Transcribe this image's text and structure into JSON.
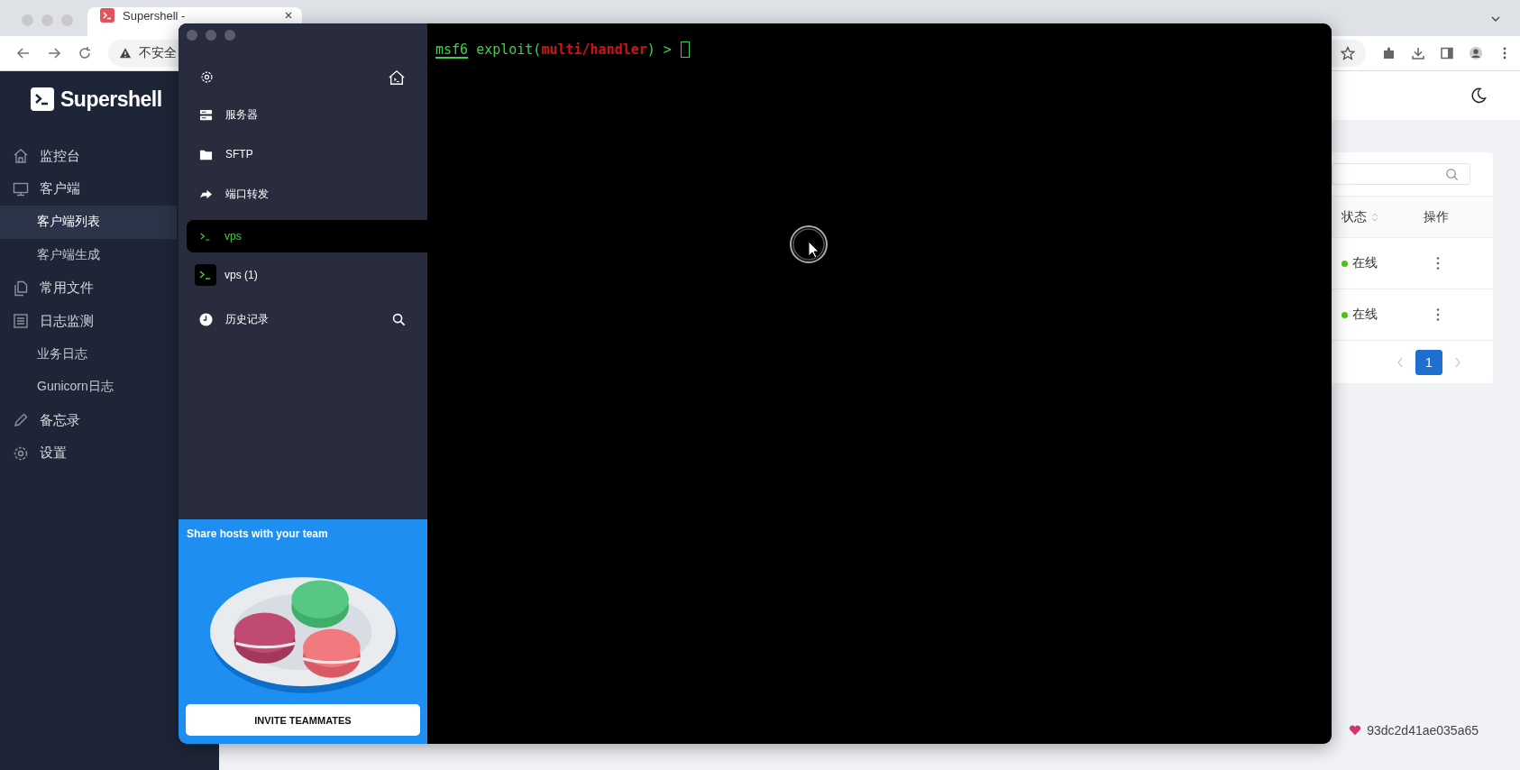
{
  "browser": {
    "tab_title": "Supershell -",
    "security_label": "不安全"
  },
  "sidebar": {
    "logo_text": "Supershell",
    "items": [
      {
        "label": "监控台",
        "selected": false
      },
      {
        "label": "客户端",
        "selected": false,
        "children": [
          {
            "label": "客户端列表",
            "selected": true
          },
          {
            "label": "客户端生成",
            "selected": false
          }
        ]
      },
      {
        "label": "常用文件",
        "selected": false
      },
      {
        "label": "日志监测",
        "selected": false,
        "children": [
          {
            "label": "业务日志",
            "selected": false
          },
          {
            "label": "Gunicorn日志",
            "selected": false
          }
        ]
      },
      {
        "label": "备忘录",
        "selected": false
      },
      {
        "label": "设置",
        "selected": false
      }
    ]
  },
  "table": {
    "columns": [
      "状态",
      "操作"
    ],
    "rows": [
      {
        "status": "在线",
        "color": "#52c41a"
      },
      {
        "status": "在线",
        "color": "#52c41a"
      }
    ]
  },
  "pagination": {
    "pages": [
      {
        "label": "1",
        "selected": true
      }
    ]
  },
  "footer": {
    "hash": "93dc2d41ae035a65"
  },
  "terminal_app": {
    "nav": [
      "服务器",
      "SFTP",
      "端口转发"
    ],
    "hosts": [
      {
        "label": "vps",
        "selected": true
      },
      {
        "label": "vps (1)",
        "selected": false
      }
    ],
    "history": "历史记录",
    "promo": {
      "title": "Share hosts with your team",
      "button": "INVITE TEAMMATES"
    },
    "prompt": [
      {
        "text": "msf6",
        "kind": "keyword"
      },
      {
        "text": " exploit(",
        "kind": "plain"
      },
      {
        "text": "multi/handler",
        "kind": "module"
      },
      {
        "text": ") >",
        "kind": "plain"
      }
    ]
  }
}
